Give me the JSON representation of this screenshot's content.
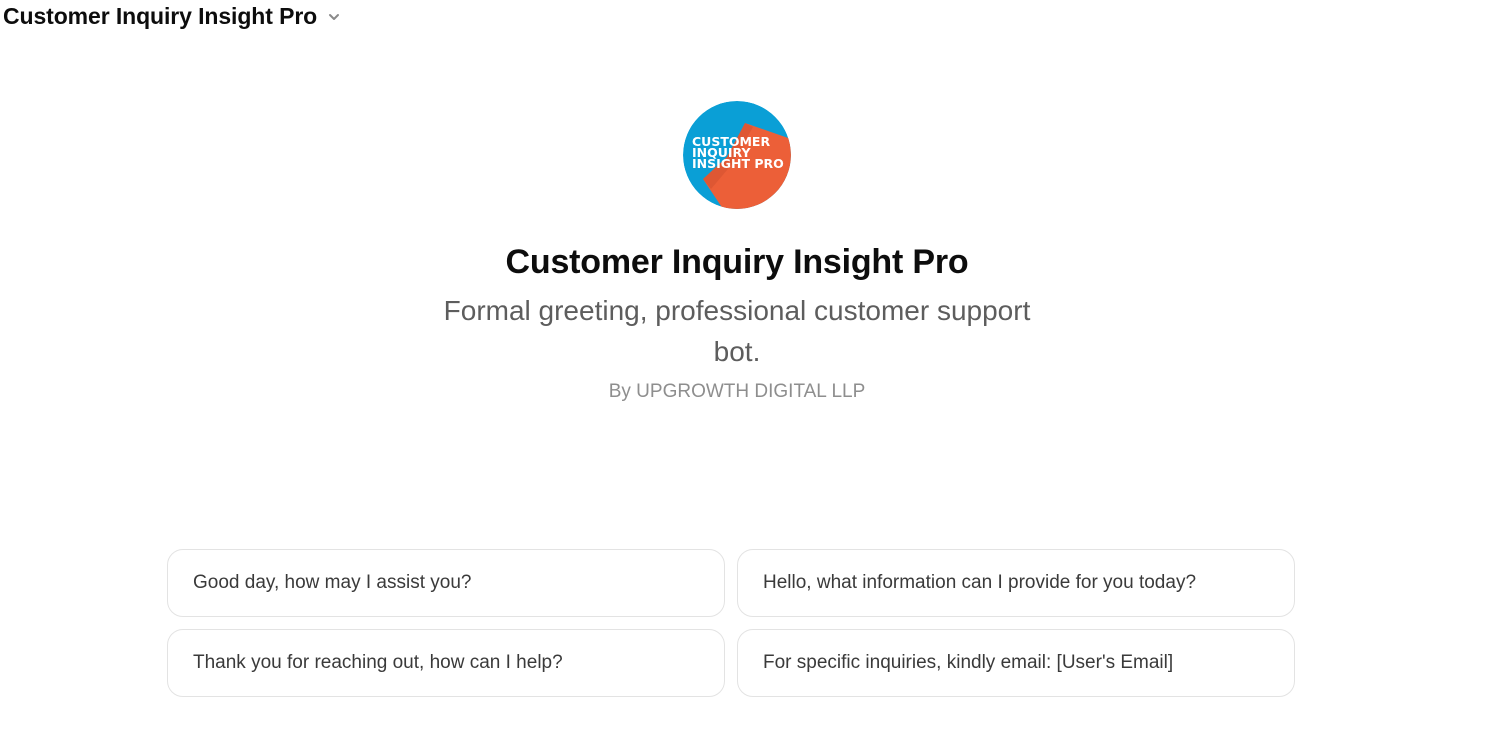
{
  "header": {
    "title": "Customer Inquiry Insight Pro",
    "dropdown_icon": "chevron-down-icon"
  },
  "gpt": {
    "logo_text": [
      "CUSTOMER",
      "INQUIRY",
      "INSIGHT PRO"
    ],
    "logo_colors": {
      "blue": "#0a9fd6",
      "orange": "#ec5f38"
    },
    "name": "Customer Inquiry Insight Pro",
    "description": "Formal greeting, professional customer support bot.",
    "author": "By UPGROWTH DIGITAL LLP"
  },
  "conversation_starters": [
    "Good day, how may I assist you?",
    "Hello, what information can I provide for you today?",
    "Thank you for reaching out, how can I help?",
    "For specific inquiries, kindly email: [User's Email]"
  ]
}
